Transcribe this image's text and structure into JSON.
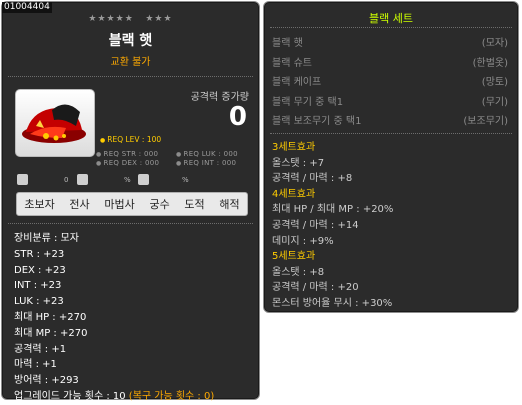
{
  "item": {
    "id": "01004404",
    "stars_left": "★★★★★",
    "stars_right": "★★★",
    "name": "블랙 햇",
    "trade": "교환 불가",
    "attack_label": "공격력 증가량",
    "attack_value": "0",
    "req_lev": "REQ LEV : 100",
    "req_str": "REQ STR : 000",
    "req_luk": "REQ LUK : 000",
    "req_dex": "REQ DEX : 000",
    "req_int": "REQ INT : 000",
    "pct1": "%",
    "pct2": "%",
    "zero1": "0",
    "zero2": "0",
    "jobs": [
      "초보자",
      "전사",
      "마법사",
      "궁수",
      "도적",
      "해적"
    ],
    "stats": [
      "장비분류 : 모자",
      "STR : +23",
      "DEX : +23",
      "INT : +23",
      "LUK : +23",
      "최대 HP : +270",
      "최대 MP : +270",
      "공격력 : +1",
      "마력 : +1",
      "방어력 : +293"
    ],
    "upgrade_text": "업그레이드 가능 횟수 : 10",
    "upgrade_restore": "(복구 가능 횟수 : 0)"
  },
  "set": {
    "title": "블랙 세트",
    "items": [
      {
        "name": "블랙 햇",
        "type": "(모자)"
      },
      {
        "name": "블랙 슈트",
        "type": "(한벌옷)"
      },
      {
        "name": "블랙 케이프",
        "type": "(망토)"
      },
      {
        "name": "블랙 무기 중 택1",
        "type": "(무기)"
      },
      {
        "name": "블랙 보조무기 중 택1",
        "type": "(보조무기)"
      }
    ],
    "effects": [
      {
        "head": "3세트효과",
        "lines": [
          "올스탯 : +7",
          "공격력 / 마력 : +8"
        ]
      },
      {
        "head": "4세트효과",
        "lines": [
          "최대 HP / 최대 MP : +20%",
          "공격력 / 마력 : +14",
          "데미지 : +9%"
        ]
      },
      {
        "head": "5세트효과",
        "lines": [
          "올스탯 : +8",
          "공격력 / 마력 : +20",
          "몬스터 방어율 무시 : +30%"
        ]
      }
    ]
  },
  "colors": {
    "panel_bg": "#2b2b2b",
    "gold": "#ffcc00",
    "orange": "#ffaa00",
    "set_title": "#ccff00"
  }
}
